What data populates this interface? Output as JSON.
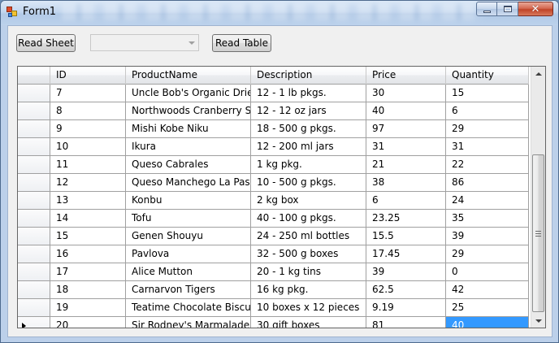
{
  "window": {
    "title": "Form1"
  },
  "toolbar": {
    "read_sheet_label": "Read Sheet",
    "combo_value": "",
    "read_table_label": "Read Table"
  },
  "grid": {
    "columns": [
      "ID",
      "ProductName",
      "Description",
      "Price",
      "Quantity"
    ],
    "rows": [
      [
        "7",
        "Uncle Bob's Organic Dried P...",
        "12 - 1 lb pkgs.",
        "30",
        "15"
      ],
      [
        "8",
        "Northwoods Cranberry Sauce",
        "12 - 12 oz jars",
        "40",
        "6"
      ],
      [
        "9",
        "Mishi Kobe Niku",
        "18 - 500 g pkgs.",
        "97",
        "29"
      ],
      [
        "10",
        "Ikura",
        "12 - 200 ml jars",
        "31",
        "31"
      ],
      [
        "11",
        "Queso Cabrales",
        "1 kg pkg.",
        "21",
        "22"
      ],
      [
        "12",
        "Queso Manchego La Pastora",
        "10 - 500 g pkgs.",
        "38",
        "86"
      ],
      [
        "13",
        "Konbu",
        "2 kg box",
        "6",
        "24"
      ],
      [
        "14",
        "Tofu",
        "40 - 100 g pkgs.",
        "23.25",
        "35"
      ],
      [
        "15",
        "Genen Shouyu",
        "24 - 250 ml bottles",
        "15.5",
        "39"
      ],
      [
        "16",
        "Pavlova",
        "32 - 500 g boxes",
        "17.45",
        "29"
      ],
      [
        "17",
        "Alice Mutton",
        "20 - 1 kg tins",
        "39",
        "0"
      ],
      [
        "18",
        "Carnarvon Tigers",
        "16 kg pkg.",
        "62.5",
        "42"
      ],
      [
        "19",
        "Teatime Chocolate Biscuits",
        "10 boxes x 12 pieces",
        "9.19",
        "25"
      ],
      [
        "20",
        "Sir Rodney's Marmalade",
        "30 gift boxes",
        "81",
        "40"
      ]
    ],
    "current_row_index": 13,
    "selected_column_index": 4
  },
  "colors": {
    "selection": "#3399ff",
    "window_frame": "#bcd0ea"
  }
}
